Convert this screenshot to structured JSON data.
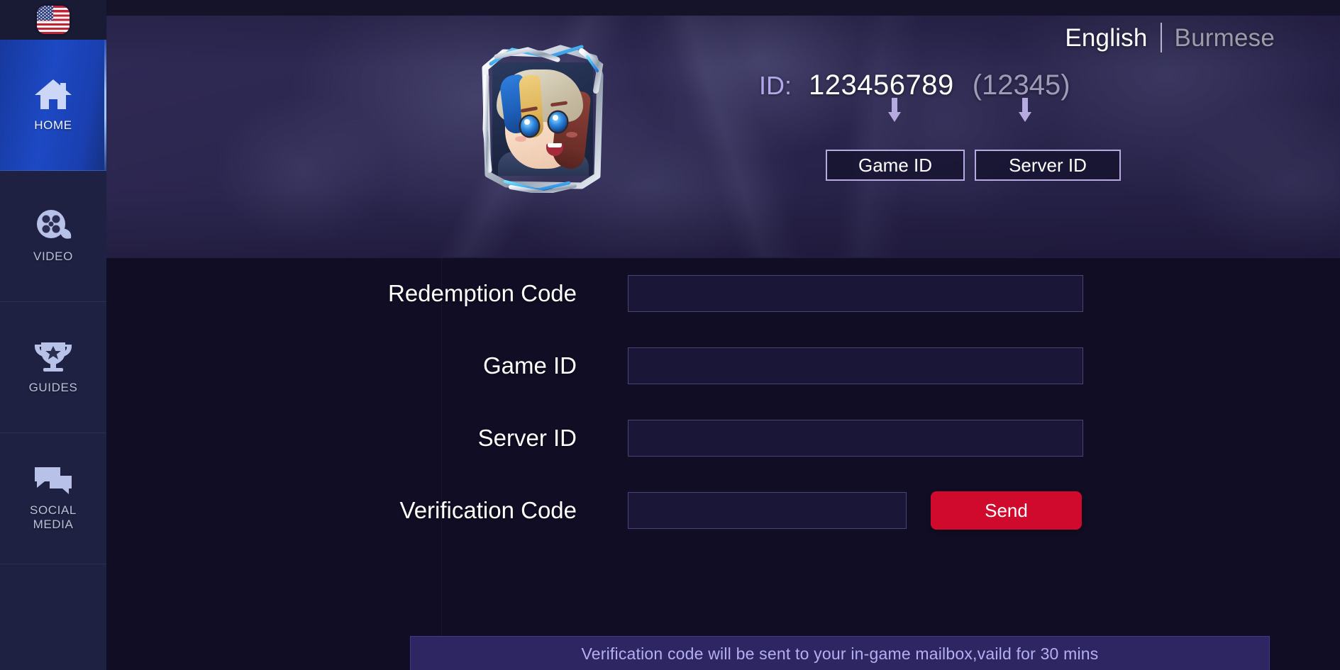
{
  "sidebar": {
    "flag": {
      "icon": "us-flag-icon",
      "alt": "United States"
    },
    "items": [
      {
        "label": "HOME",
        "icon": "home-icon",
        "active": true
      },
      {
        "label": "VIDEO",
        "icon": "film-icon",
        "active": false
      },
      {
        "label": "GUIDES",
        "icon": "trophy-icon",
        "active": false
      },
      {
        "label": "SOCIAL\nMEDIA",
        "icon": "chat-icon",
        "active": false
      }
    ]
  },
  "header": {
    "languages": [
      {
        "label": "English",
        "active": true
      },
      {
        "label": "Burmese",
        "active": false
      }
    ],
    "id_label": "ID:",
    "id_value": "123456789",
    "server_value": "(12345)",
    "tags": [
      {
        "label": "Game ID"
      },
      {
        "label": "Server ID"
      }
    ],
    "avatar": {
      "icon": "player-avatar",
      "alt": "Player avatar portrait"
    }
  },
  "form": {
    "rows": [
      {
        "label": "Redemption Code",
        "value": "",
        "placeholder": ""
      },
      {
        "label": "Game ID",
        "value": "",
        "placeholder": ""
      },
      {
        "label": "Server ID",
        "value": "",
        "placeholder": ""
      },
      {
        "label": "Verification Code",
        "value": "",
        "placeholder": ""
      }
    ],
    "send_label": "Send"
  },
  "notice": {
    "text": "Verification code will be sent to your in-game mailbox,vaild for 30 mins"
  },
  "colors": {
    "accent_blue": "#1d49c4",
    "send_red": "#d00a2c",
    "lavender": "#b0a8e8",
    "notice_bg": "#2e2663",
    "panel_bg": "#110d24",
    "sidebar_bg": "#1f2142"
  }
}
